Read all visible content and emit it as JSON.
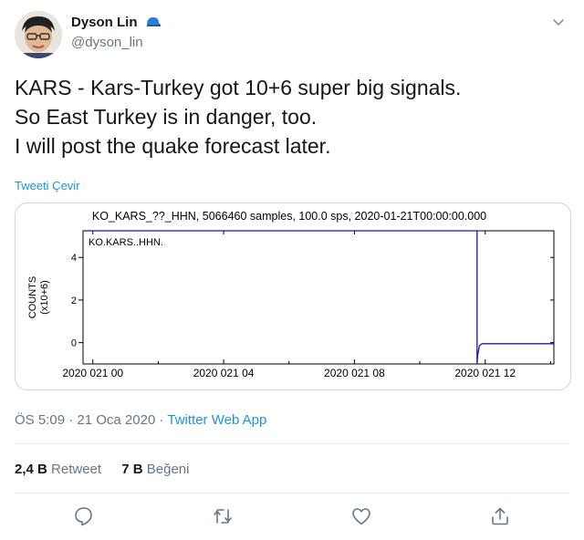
{
  "author": {
    "name": "Dyson Lin",
    "handle": "@dyson_lin",
    "badge_icon": "blue-cap-icon",
    "avatar_icon": "profile-photo"
  },
  "tweet": {
    "lines": [
      "KARS - Kars-Turkey got 10+6 super big signals.",
      "So East Turkey is in danger, too.",
      "I will post the quake forecast later."
    ],
    "translate_label": "Tweeti Çevir"
  },
  "chart_data": {
    "type": "line",
    "title": "KO_KARS_??_HHN, 5066460 samples, 100.0 sps, 2020-01-21T00:00:00.000",
    "trace_label": "KO.KARS..HHN.",
    "ylabel": "COUNTS (x10+6)",
    "ylabel_line1": "COUNTS",
    "ylabel_line2": "(x10+6)",
    "y_ticks": [
      0,
      2,
      4
    ],
    "x_tick_labels": [
      "2020 021 00",
      "2020 021 04",
      "2020 021 08",
      "2020 021 12"
    ],
    "x_tick_hours": [
      0,
      4,
      8,
      12
    ],
    "xlim_hours": [
      -0.3,
      14.1
    ],
    "ylim": [
      -1.0,
      5.25
    ],
    "series": [
      {
        "color": "#1a1aa8",
        "x_hours": [
          -0.3,
          11.75,
          11.75,
          11.77,
          11.82,
          11.9,
          12.0,
          14.1
        ],
        "values": [
          5.25,
          5.25,
          -1.0,
          -0.6,
          -0.15,
          -0.05,
          -0.05,
          -0.05
        ]
      }
    ]
  },
  "meta": {
    "time": "ÖS 5:09",
    "date": "21 Oca 2020",
    "separator": "·",
    "app": "Twitter Web App"
  },
  "stats": {
    "retweets_count": "2,4 B",
    "retweets_label": "Retweet",
    "likes_count": "7 B",
    "likes_label": "Beğeni"
  },
  "actions": {
    "reply_icon": "reply-icon",
    "retweet_icon": "retweet-icon",
    "like_icon": "heart-icon",
    "share_icon": "share-icon"
  },
  "colors": {
    "link": "#1b95e0",
    "muted": "#657786",
    "trace": "#1a1aa8",
    "border": "#ccd6dd"
  }
}
